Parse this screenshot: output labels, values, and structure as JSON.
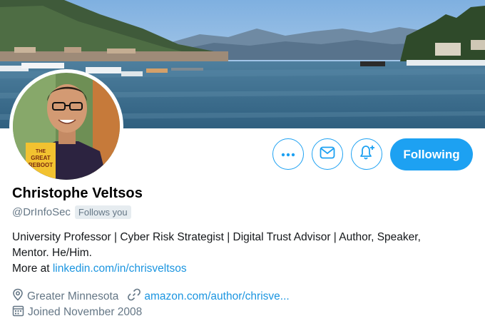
{
  "profile": {
    "name": "Christophe Veltsos",
    "handle": "@DrInfoSec",
    "follows_you": "Follows you",
    "bio_line1": "University Professor | Cyber Risk Strategist | Digital Trust Advisor | Author, Speaker,",
    "bio_line2": "Mentor. He/Him.",
    "bio_more_prefix": "More at ",
    "bio_link": "linkedin.com/in/chrisveltsos",
    "location": "Greater Minnesota",
    "website": "amazon.com/author/chrisve...",
    "joined": "Joined November 2008",
    "avatar_book_text": [
      "THE",
      "GREAT",
      "REBOOT"
    ]
  },
  "actions": {
    "more_icon": "ellipsis-icon",
    "message_icon": "envelope-icon",
    "notify_icon": "bell-plus-icon",
    "following_label": "Following"
  },
  "colors": {
    "accent": "#1da1f2",
    "link": "#1b95e0",
    "secondary_text": "#657786"
  }
}
